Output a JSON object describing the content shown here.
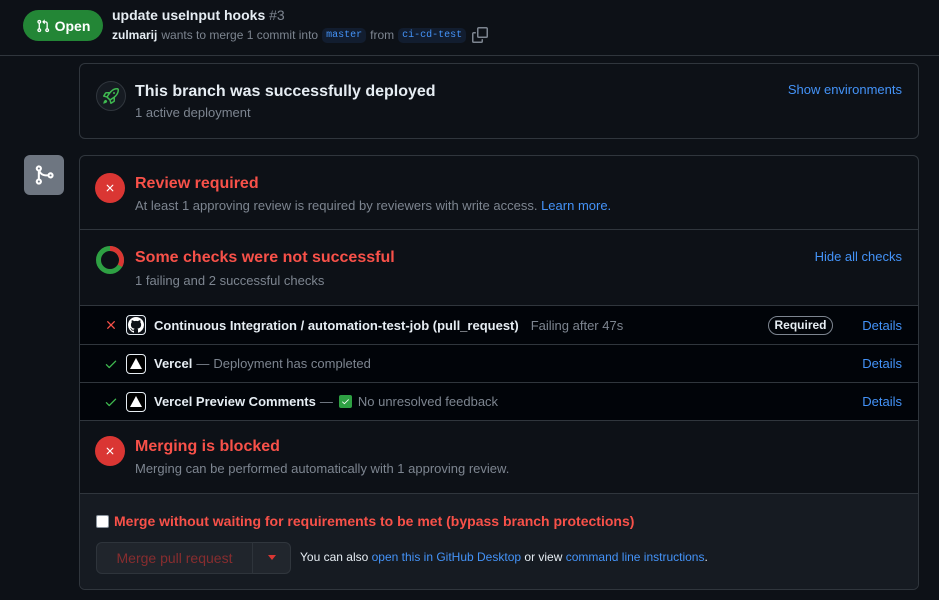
{
  "header": {
    "state": "Open",
    "title": "update useInput hooks",
    "number": "#3",
    "author": "zulmarij",
    "meta_text": "wants to merge 1 commit into",
    "base_branch": "master",
    "from_text": "from",
    "head_branch": "ci-cd-test"
  },
  "deployment": {
    "title": "This branch was successfully deployed",
    "subtitle": "1 active deployment",
    "show_link": "Show environments"
  },
  "review": {
    "title": "Review required",
    "subtitle": "At least 1 approving review is required by reviewers with write access.",
    "learn_more": "Learn more."
  },
  "checks": {
    "title": "Some checks were not successful",
    "subtitle": "1 failing and 2 successful checks",
    "toggle_link": "Hide all checks",
    "items": [
      {
        "status": "failure",
        "app_icon": "github-icon",
        "name": "Continuous Integration / automation-test-job (pull_request)",
        "description": "Failing after 47s",
        "badge": "Required",
        "details": "Details"
      },
      {
        "status": "success",
        "app_icon": "vercel-icon",
        "name": "Vercel",
        "separator": "—",
        "description": "Deployment has completed",
        "details": "Details"
      },
      {
        "status": "success",
        "app_icon": "vercel-icon",
        "name": "Vercel Preview Comments",
        "separator": "—",
        "description": "No unresolved feedback",
        "details": "Details"
      }
    ]
  },
  "blocked": {
    "title": "Merging is blocked",
    "subtitle": "Merging can be performed automatically with 1 approving review."
  },
  "merge": {
    "bypass_label": "Merge without waiting for requirements to be met (bypass branch protections)",
    "bypass_checked": false,
    "button_label": "Merge pull request",
    "alt_prefix": "You can also",
    "desktop_link": "open this in GitHub Desktop",
    "alt_middle": "or view",
    "cli_link": "command line instructions",
    "alt_suffix": "."
  },
  "colors": {
    "open_green": "#238636",
    "danger": "#f85149",
    "success": "#3fb950",
    "link": "#4493f8"
  }
}
